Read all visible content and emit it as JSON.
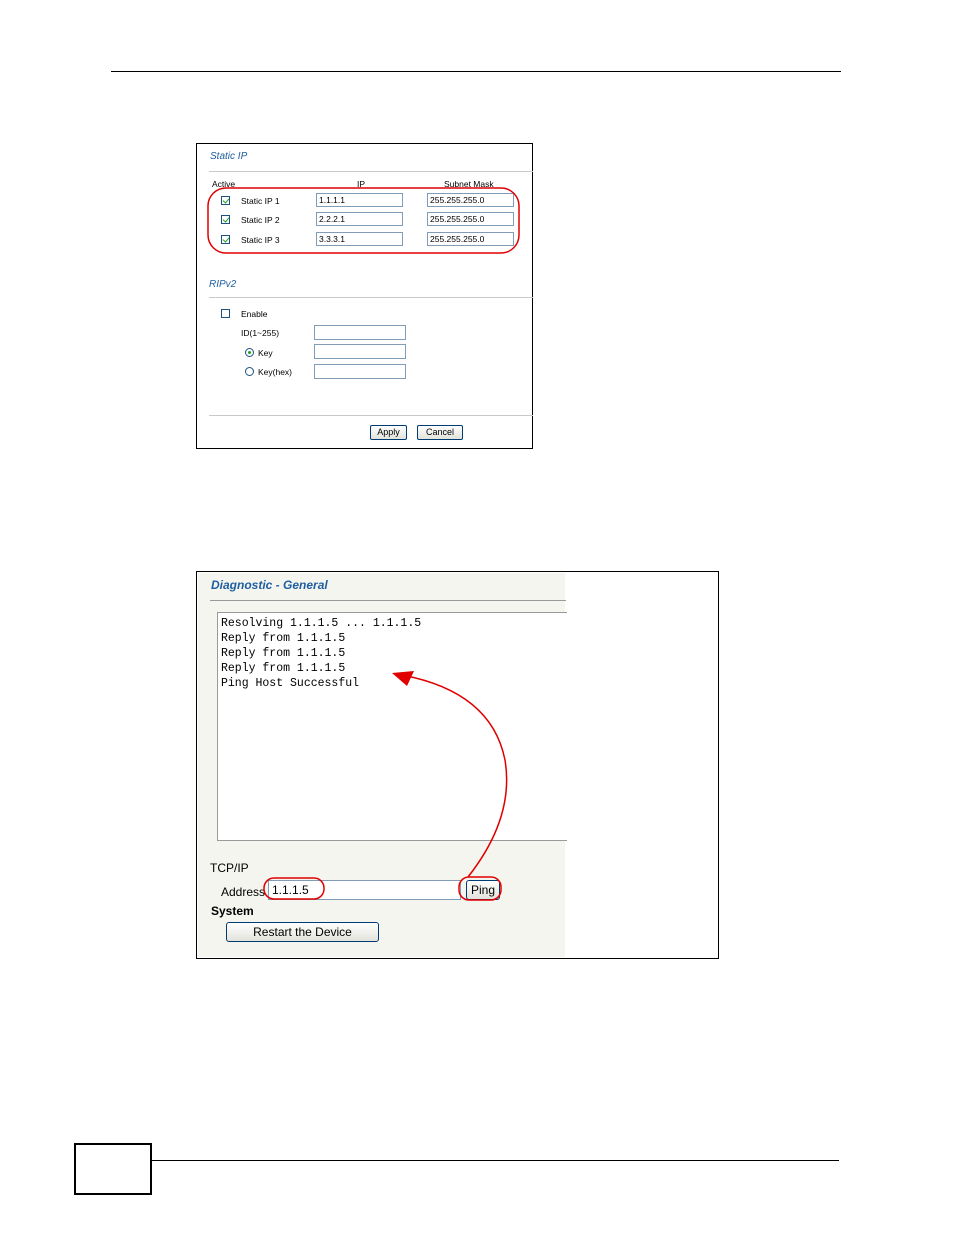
{
  "static_ip": {
    "title": "Static IP",
    "col_active": "Active",
    "col_ip": "IP",
    "col_mask": "Subnet Mask",
    "rows": [
      {
        "label": "Static IP 1",
        "ip": "1.1.1.1",
        "mask": "255.255.255.0",
        "checked": true
      },
      {
        "label": "Static IP 2",
        "ip": "2.2.2.1",
        "mask": "255.255.255.0",
        "checked": true
      },
      {
        "label": "Static IP 3",
        "ip": "3.3.3.1",
        "mask": "255.255.255.0",
        "checked": true
      }
    ]
  },
  "ripv2": {
    "title": "RIPv2",
    "enable_label": "Enable",
    "enable_checked": false,
    "id_label": "ID(1~255)",
    "id_value": "",
    "key_label": "Key",
    "key_value": "",
    "keyhex_label": "Key(hex)",
    "keyhex_value": "",
    "selected_key_type": "Key"
  },
  "buttons": {
    "apply": "Apply",
    "cancel": "Cancel"
  },
  "diagnostic": {
    "title": "Diagnostic - General",
    "output_lines": [
      "Resolving 1.1.1.5 ... 1.1.1.5",
      "Reply from 1.1.1.5",
      "Reply from 1.1.1.5",
      "Reply from 1.1.1.5",
      "Ping Host Successful"
    ],
    "tcpip_label": "TCP/IP",
    "address_label": "Address",
    "address_value": "1.1.1.5",
    "ping_label": "Ping",
    "system_label": "System",
    "restart_label": "Restart the Device"
  },
  "colors": {
    "annotation": "#e00000",
    "section_title": "#1f5fa0"
  }
}
